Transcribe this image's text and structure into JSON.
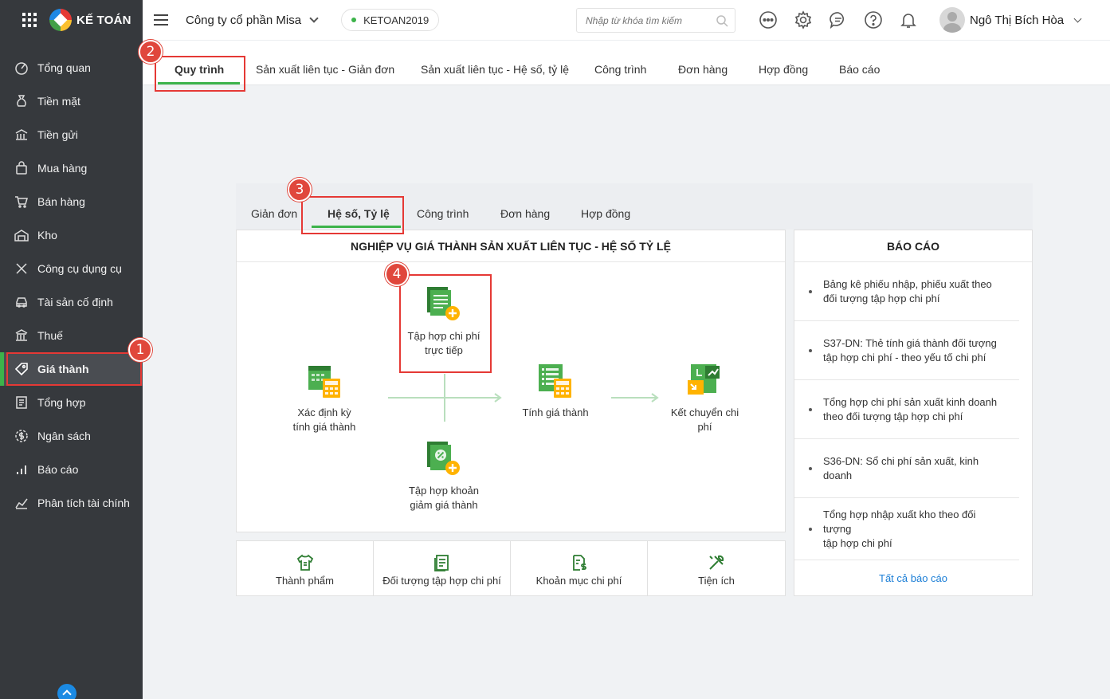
{
  "app": {
    "brand": "KẾ TOÁN"
  },
  "sidebar": {
    "items": [
      {
        "label": "Tổng quan",
        "icon": "dashboard-icon"
      },
      {
        "label": "Tiền mặt",
        "icon": "money-bag-icon"
      },
      {
        "label": "Tiền gửi",
        "icon": "bank-icon"
      },
      {
        "label": "Mua hàng",
        "icon": "shopping-bag-icon"
      },
      {
        "label": "Bán hàng",
        "icon": "cart-icon"
      },
      {
        "label": "Kho",
        "icon": "warehouse-icon"
      },
      {
        "label": "Công cụ dụng cụ",
        "icon": "tools-icon"
      },
      {
        "label": "Tài sản cố định",
        "icon": "car-icon"
      },
      {
        "label": "Thuế",
        "icon": "building-icon"
      },
      {
        "label": "Giá thành",
        "icon": "price-tag-icon",
        "active": true
      },
      {
        "label": "Tổng hợp",
        "icon": "ledger-icon"
      },
      {
        "label": "Ngân sách",
        "icon": "budget-icon"
      },
      {
        "label": "Báo cáo",
        "icon": "bar-chart-icon"
      },
      {
        "label": "Phân tích tài chính",
        "icon": "line-chart-icon"
      }
    ]
  },
  "header": {
    "company": "Công ty cổ phần Misa",
    "database": "KETOAN2019",
    "search_placeholder": "Nhập từ khóa tìm kiếm",
    "user_name": "Ngô Thị Bích Hòa"
  },
  "top_tabs": [
    "Quy trình",
    "Sản xuất liên tục - Giản đơn",
    "Sản xuất liên tục - Hệ số, tỷ lệ",
    "Công trình",
    "Đơn hàng",
    "Hợp đồng",
    "Báo cáo"
  ],
  "sub_tabs": [
    "Giản đơn",
    "Hệ số, Tỷ lệ",
    "Công trình",
    "Đơn hàng",
    "Hợp đồng"
  ],
  "workflow": {
    "title": "NGHIỆP VỤ GIÁ THÀNH SẢN XUẤT LIÊN TỤC - HỆ SỐ TỶ LỆ",
    "nodes": {
      "period_line1": "Xác định kỳ",
      "period_line2": "tính giá thành",
      "direct_line1": "Tập hợp chi phí",
      "direct_line2": "trực tiếp",
      "reduce_line1": "Tập hợp khoản",
      "reduce_line2": "giảm giá thành",
      "calc": "Tính giá thành",
      "transfer_line1": "Kết chuyển chi",
      "transfer_line2": "phí"
    }
  },
  "reports": {
    "title": "BÁO CÁO",
    "items": [
      {
        "line1": "Bảng kê phiếu nhập, phiếu xuất theo",
        "line2": "đối tượng tập hợp chi phí"
      },
      {
        "line1": "S37-DN: Thẻ tính giá thành đối tượng",
        "line2": "tập hợp chi phí - theo yếu tố chi phí"
      },
      {
        "line1": "Tổng hợp chi phí sản xuất kinh doanh",
        "line2": "theo đối tượng tập hợp chi phí"
      },
      {
        "line1": "S36-DN: Sổ chi phí sản xuất, kinh doanh",
        "line2": ""
      },
      {
        "line1": "Tổng hợp nhập xuất kho theo đối tượng",
        "line2": "tập hợp chi phí"
      }
    ],
    "all_link": "Tất cả báo cáo"
  },
  "utilities": [
    "Thành phẩm",
    "Đối tượng tập hợp chi phí",
    "Khoản mục chi phí",
    "Tiện ích"
  ],
  "callouts": [
    "1",
    "2",
    "3",
    "4"
  ],
  "colors": {
    "accent_green": "#3cb34a",
    "sidebar_bg": "#36393d",
    "highlight_red": "#e53935",
    "link_blue": "#1b7ed6"
  }
}
